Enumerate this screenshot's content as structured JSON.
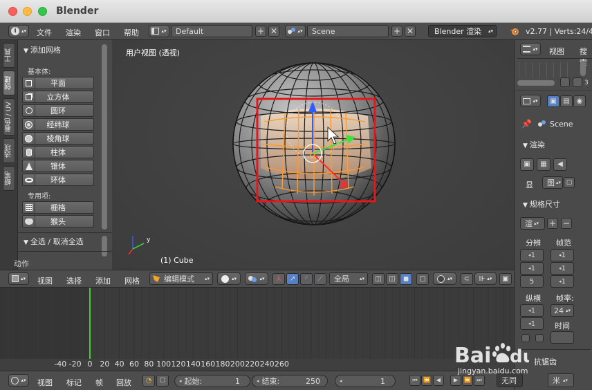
{
  "window": {
    "title": "Blender"
  },
  "info_header": {
    "menus": [
      "文件",
      "渲染",
      "窗口",
      "帮助"
    ],
    "screen_layout": "Default",
    "scene": "Scene",
    "render_engine": "Blender 渲染",
    "version": "v2.77 | Verts:24/48"
  },
  "left_tabs": [
    "工具",
    "创建",
    "着色 / UV",
    "选项",
    "蜡笔"
  ],
  "tool_shelf": {
    "add_mesh_header": "添加网格",
    "primitives_label": "基本体:",
    "primitives": [
      {
        "label": "平面",
        "icon": "plane-icon"
      },
      {
        "label": "立方体",
        "icon": "cube-icon"
      },
      {
        "label": "圆环",
        "icon": "circle-icon"
      },
      {
        "label": "经纬球",
        "icon": "uv-sphere-icon"
      },
      {
        "label": "棱角球",
        "icon": "ico-sphere-icon"
      },
      {
        "label": "柱体",
        "icon": "cylinder-icon"
      },
      {
        "label": "锥体",
        "icon": "cone-icon"
      },
      {
        "label": "环体",
        "icon": "torus-icon"
      }
    ],
    "special_label": "专用项:",
    "special": [
      {
        "label": "栅格",
        "icon": "grid-icon"
      },
      {
        "label": "猴头",
        "icon": "monkey-icon"
      }
    ],
    "select_header": "全选 / 取消全选",
    "operator_label": "动作"
  },
  "viewport": {
    "view_label": "用户视图 (透视)",
    "object_label": "(1) Cube",
    "axis_y": "y"
  },
  "right_top": {
    "view_menu": "视图",
    "search_menu": "搜索",
    "mini_number": "3"
  },
  "properties": {
    "scene_name": "Scene",
    "render_header": "渲染",
    "display_label": "显",
    "display_value": "图",
    "dimensions_header": "规格尺寸",
    "preset_value": "渲",
    "resolution_label": "分辨",
    "frame_range_label": "帧范",
    "res_x": "1",
    "res_y": "1",
    "percent": "5",
    "frame_start": "1",
    "frame_end": "1",
    "frame_step": "1",
    "aspect_label": "纵横",
    "aspect_x": "1",
    "aspect_y": "1",
    "frame_rate_label": "帧率:",
    "frame_rate_value": "24",
    "time_label": "时间",
    "antialias_label": "抗锯齿"
  },
  "view3d_header": {
    "menus": [
      "视图",
      "选择",
      "添加",
      "网格"
    ],
    "mode": "编辑模式",
    "pivot": "全局"
  },
  "timeline": {
    "ticks": [
      "-40",
      "-20",
      "0",
      "20",
      "40",
      "60",
      "80",
      "100",
      "120",
      "140",
      "160",
      "180",
      "200",
      "220",
      "240",
      "260"
    ],
    "current_frame": 0,
    "menus": [
      "视图",
      "标记",
      "帧",
      "回放"
    ],
    "start_label": "起始:",
    "start_value": "1",
    "end_label": "结束:",
    "end_value": "250",
    "current_value": "1",
    "sync_value": "无同",
    "units_value": "米"
  },
  "watermark": {
    "brand": "Baidu",
    "url": "jingyan.baidu.com"
  },
  "colors": {
    "accent_blue": "#5680c2",
    "selection_orange": "#ff9a2e",
    "annotation_red": "#e8161b",
    "playhead_green": "#43d12a"
  }
}
